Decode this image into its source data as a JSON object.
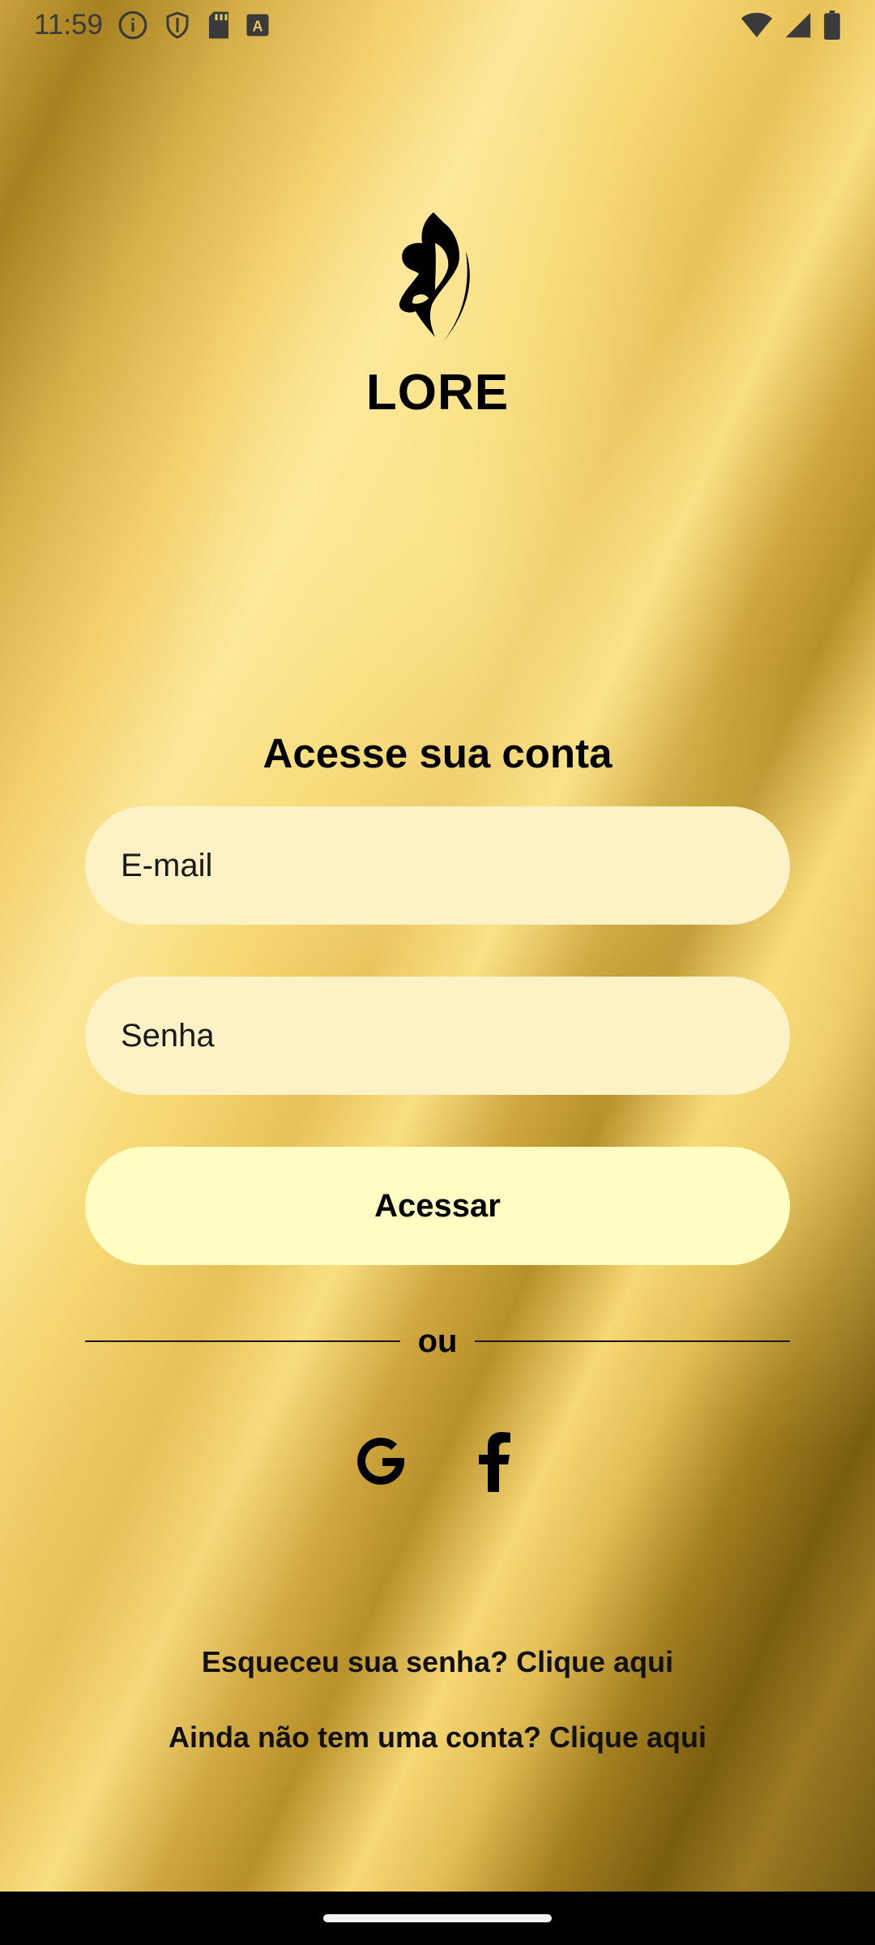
{
  "status_bar": {
    "time": "11:59",
    "left_icons": [
      "info-icon",
      "shield-icon",
      "sd-card-icon",
      "keyboard-a-icon"
    ],
    "right_icons": [
      "wifi-icon",
      "signal-icon",
      "battery-icon"
    ]
  },
  "app": {
    "name": "LORE",
    "logo_icon": "butterfly-icon"
  },
  "login": {
    "heading": "Acesse sua conta",
    "email_placeholder": "E-mail",
    "password_placeholder": "Senha",
    "submit_label": "Acessar",
    "divider_text": "ou",
    "social": [
      "google-icon",
      "facebook-icon"
    ],
    "forgot_link": "Esqueceu sua senha? Clique aqui",
    "signup_link": "Ainda não tem uma conta? Clique aqui"
  },
  "colors": {
    "input_bg": "#fdf1c6",
    "button_bg": "#fffdc2",
    "gold": "#e8c157"
  }
}
